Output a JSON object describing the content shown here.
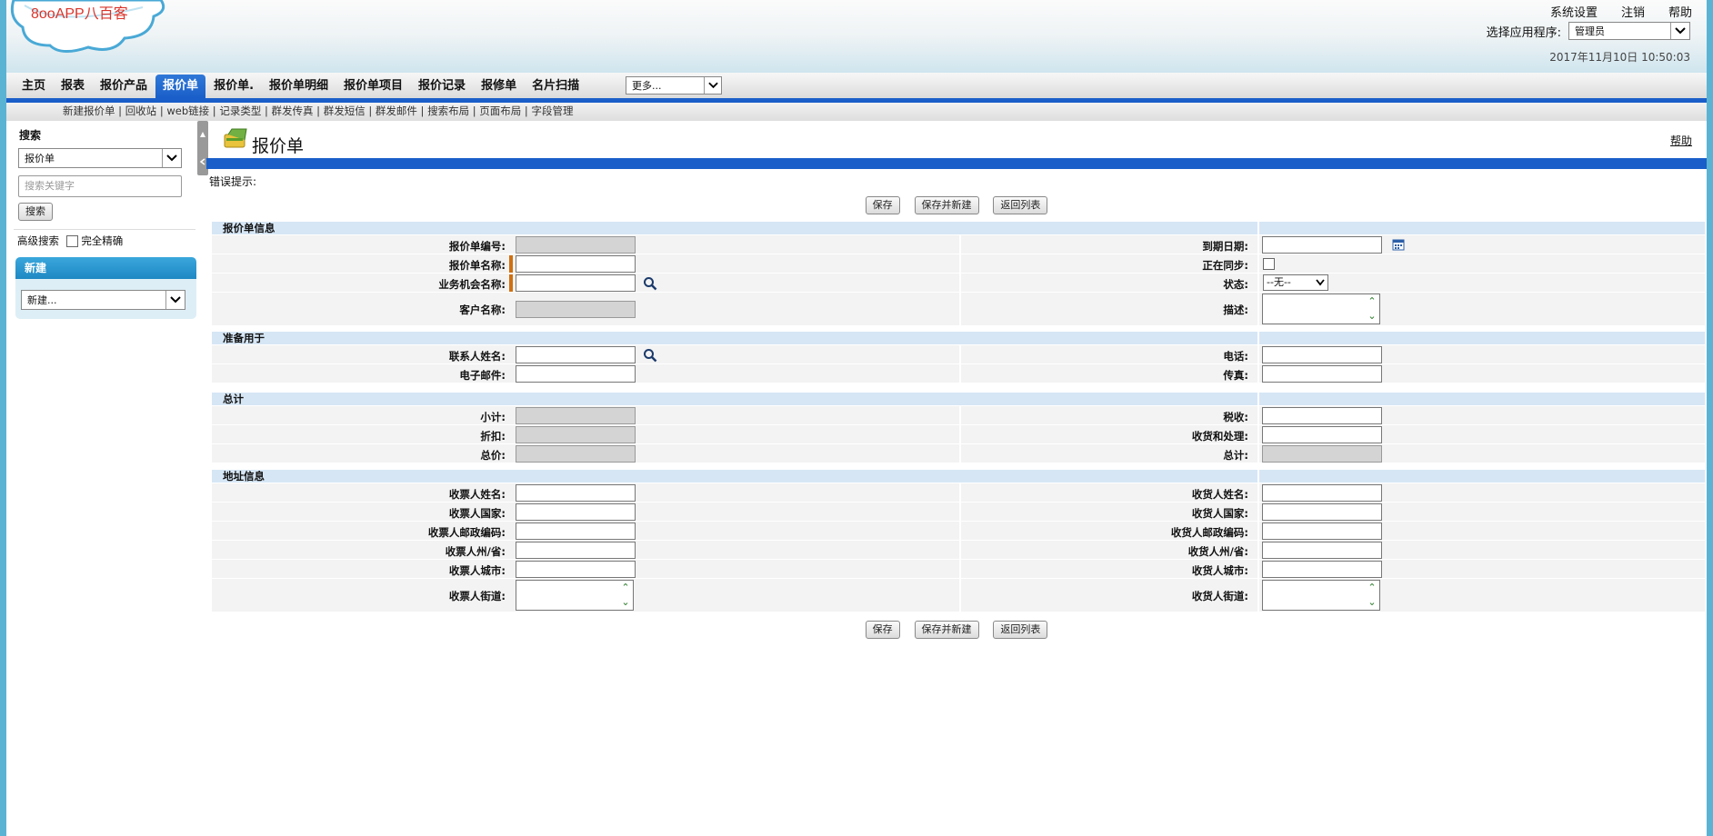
{
  "logo": {
    "text": "8ooAPP八百客"
  },
  "top_links": [
    "系统设置",
    "注销",
    "帮助"
  ],
  "app_selector": {
    "label": "选择应用程序:",
    "value": "管理员"
  },
  "datetime": "2017年11月10日 10:50:03",
  "nav": {
    "items": [
      "主页",
      "报表",
      "报价产品",
      "报价单",
      "报价单.",
      "报价单明细",
      "报价单项目",
      "报价记录",
      "报修单",
      "名片扫描"
    ],
    "active_index": 3,
    "more_label": "更多..."
  },
  "subnav": [
    "新建报价单",
    "回收站",
    "web链接",
    "记录类型",
    "群发传真",
    "群发短信",
    "群发邮件",
    "搜索布局",
    "页面布局",
    "字段管理"
  ],
  "sidebar": {
    "search_title": "搜索",
    "search_object": "报价单",
    "search_placeholder": "搜索关键字",
    "search_button": "搜索",
    "advanced_search": "高级搜索",
    "exact_match": "完全精确",
    "new_title": "新建",
    "new_select": "新建..."
  },
  "main": {
    "title": "报价单",
    "help": "帮助",
    "error_hint": "错误提示:",
    "buttons": {
      "save": "保存",
      "save_new": "保存并新建",
      "back": "返回列表"
    },
    "sections": {
      "info": {
        "title": "报价单信息",
        "quote_no": "报价单编号:",
        "quote_name": "报价单名称:",
        "opportunity": "业务机会名称:",
        "customer": "客户名称:",
        "due_date": "到期日期:",
        "syncing": "正在同步:",
        "status": "状态:",
        "status_value": "--无--",
        "description": "描述:"
      },
      "prepared": {
        "title": "准备用于",
        "contact": "联系人姓名:",
        "email": "电子邮件:",
        "phone": "电话:",
        "fax": "传真:"
      },
      "totals": {
        "title": "总计",
        "subtotal": "小计:",
        "discount": "折扣:",
        "total_price": "总价:",
        "tax": "税收:",
        "shipping": "收货和处理:",
        "grand_total": "总计:"
      },
      "address": {
        "title": "地址信息",
        "bill_name": "收票人姓名:",
        "bill_country": "收票人国家:",
        "bill_zip": "收票人邮政编码:",
        "bill_state": "收票人州/省:",
        "bill_city": "收票人城市:",
        "bill_street": "收票人街道:",
        "ship_name": "收货人姓名:",
        "ship_country": "收货人国家:",
        "ship_zip": "收货人邮政编码:",
        "ship_state": "收货人州/省:",
        "ship_city": "收货人城市:",
        "ship_street": "收货人街道:"
      }
    }
  },
  "colors": {
    "nav_blue": "#1a5fc9",
    "section_bg": "#d6e6f5",
    "required": "#d07010",
    "sidebar_new": "#1e88c4"
  }
}
